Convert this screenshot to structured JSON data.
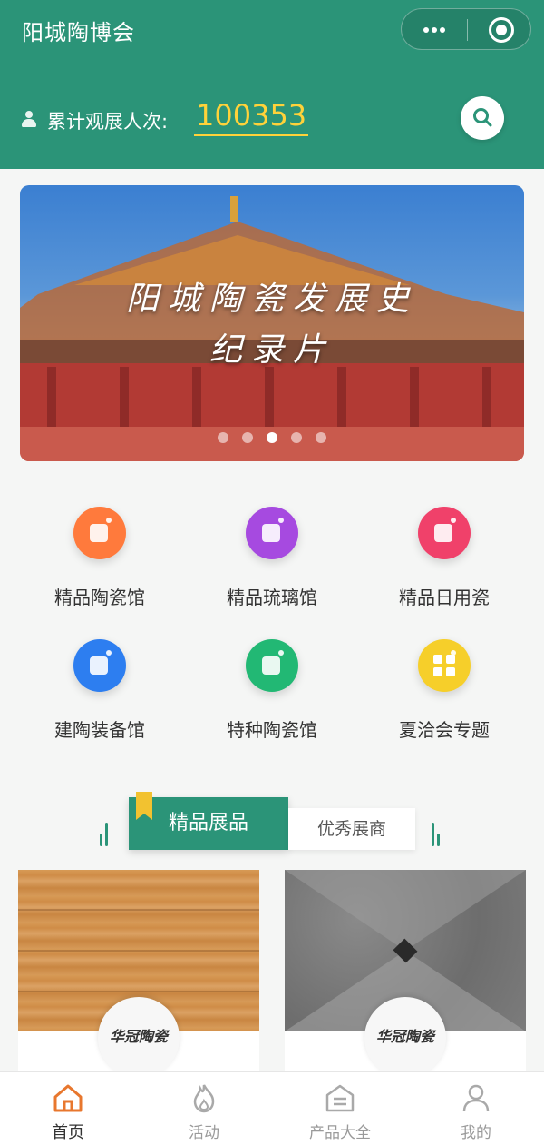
{
  "header": {
    "title": "阳城陶博会",
    "visitor_label": "累计观展人次:",
    "visitor_count": "100353",
    "icons": [
      "more-icon",
      "close-icon",
      "person-icon",
      "search-icon"
    ]
  },
  "banner": {
    "title": "阳城陶瓷发展史",
    "subtitle": "纪录片",
    "slide_count": 5,
    "active_slide": 3
  },
  "categories": [
    {
      "label": "精品陶瓷馆",
      "color": "#ff7a3c"
    },
    {
      "label": "精品琉璃馆",
      "color": "#a64ae0"
    },
    {
      "label": "精品日用瓷",
      "color": "#f0416a"
    },
    {
      "label": "建陶装备馆",
      "color": "#2d7ef0"
    },
    {
      "label": "特种陶瓷馆",
      "color": "#22b874"
    },
    {
      "label": "夏洽会专题",
      "color": "#f6cf2a"
    }
  ],
  "tabs": {
    "active": "精品展品",
    "other": "优秀展商"
  },
  "products": [
    {
      "brand": "华冠陶瓷"
    },
    {
      "brand": "华冠陶瓷"
    }
  ],
  "nav": {
    "items": [
      {
        "label": "首页",
        "icon": "home-icon"
      },
      {
        "label": "活动",
        "icon": "flame-icon"
      },
      {
        "label": "产品大全",
        "icon": "catalog-icon"
      },
      {
        "label": "我的",
        "icon": "user-icon"
      }
    ]
  },
  "colors": {
    "primary": "#2b9478",
    "accent_yellow": "#ffd23a",
    "nav_active": "#e8772e"
  }
}
